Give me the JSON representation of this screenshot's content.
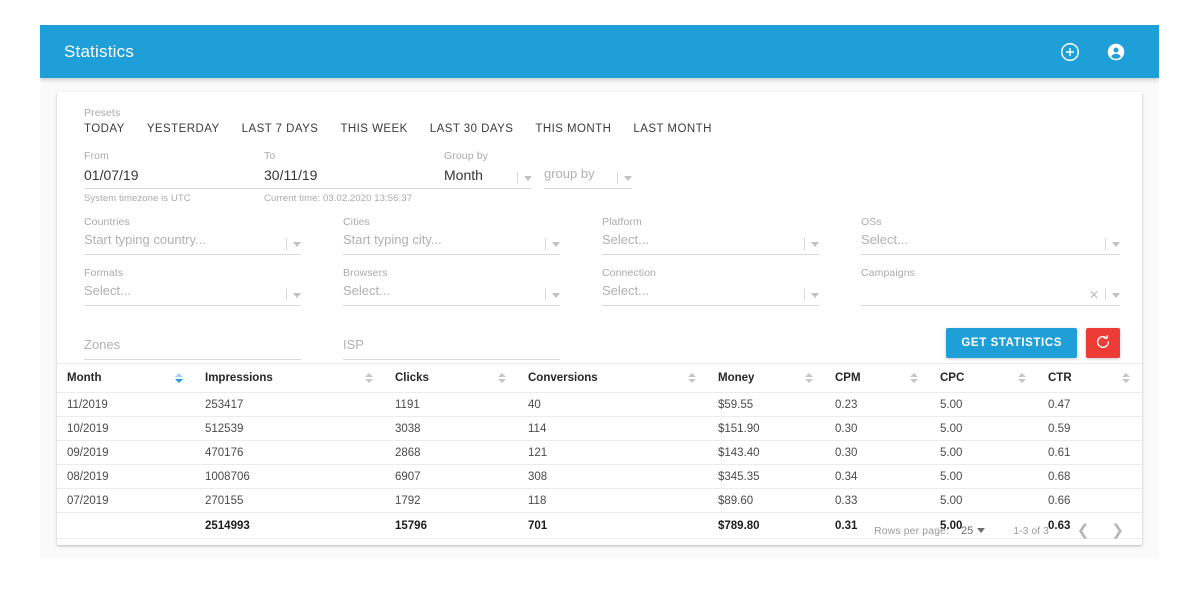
{
  "appbar": {
    "title": "Statistics",
    "add_icon": "plus-circle-icon",
    "account_icon": "account-circle-icon"
  },
  "colors": {
    "primary": "#1e9fd8",
    "danger": "#ed3b35",
    "surface": "#ffffff",
    "background": "#fafafa"
  },
  "filters": {
    "presets_label": "Presets",
    "presets": [
      "TODAY",
      "YESTERDAY",
      "LAST 7 DAYS",
      "THIS WEEK",
      "LAST 30 DAYS",
      "THIS MONTH",
      "LAST MONTH"
    ],
    "from": {
      "label": "From",
      "value": "01/07/19",
      "helper": "System timezone is UTC"
    },
    "to": {
      "label": "To",
      "value": "30/11/19",
      "helper": "Current time: 03.02.2020 13:56:37"
    },
    "group_by": {
      "label": "Group by",
      "primary_value": "Month",
      "secondary_placeholder": "group by"
    },
    "countries": {
      "label": "Countries",
      "placeholder": "Start typing country..."
    },
    "cities": {
      "label": "Cities",
      "placeholder": "Start typing city..."
    },
    "platform": {
      "label": "Platform",
      "placeholder": "Select..."
    },
    "oss": {
      "label": "OSs",
      "placeholder": "Select..."
    },
    "formats": {
      "label": "Formats",
      "placeholder": "Select..."
    },
    "browsers": {
      "label": "Browsers",
      "placeholder": "Select..."
    },
    "connection": {
      "label": "Connection",
      "placeholder": "Select..."
    },
    "campaigns": {
      "label": "Campaigns",
      "placeholder": "",
      "clear_icon": "close-x-icon"
    },
    "zones": {
      "placeholder": "Zones"
    },
    "isp": {
      "placeholder": "ISP"
    }
  },
  "actions": {
    "get_statistics": "GET STATISTICS",
    "reset_icon": "refresh-ccw-icon"
  },
  "table": {
    "columns": [
      {
        "label": "Month",
        "sorted": true
      },
      {
        "label": "Impressions",
        "sorted": false
      },
      {
        "label": "Clicks",
        "sorted": false
      },
      {
        "label": "Conversions",
        "sorted": false
      },
      {
        "label": "Money",
        "sorted": false
      },
      {
        "label": "CPM",
        "sorted": false
      },
      {
        "label": "CPC",
        "sorted": false
      },
      {
        "label": "CTR",
        "sorted": false
      }
    ],
    "rows": [
      {
        "month": "11/2019",
        "impressions": "253417",
        "clicks": "1191",
        "conversions": "40",
        "money": "$59.55",
        "cpm": "0.23",
        "cpc": "5.00",
        "ctr": "0.47"
      },
      {
        "month": "10/2019",
        "impressions": "512539",
        "clicks": "3038",
        "conversions": "114",
        "money": "$151.90",
        "cpm": "0.30",
        "cpc": "5.00",
        "ctr": "0.59"
      },
      {
        "month": "09/2019",
        "impressions": "470176",
        "clicks": "2868",
        "conversions": "121",
        "money": "$143.40",
        "cpm": "0.30",
        "cpc": "5.00",
        "ctr": "0.61"
      },
      {
        "month": "08/2019",
        "impressions": "1008706",
        "clicks": "6907",
        "conversions": "308",
        "money": "$345.35",
        "cpm": "0.34",
        "cpc": "5.00",
        "ctr": "0.68"
      },
      {
        "month": "07/2019",
        "impressions": "270155",
        "clicks": "1792",
        "conversions": "118",
        "money": "$89.60",
        "cpm": "0.33",
        "cpc": "5.00",
        "ctr": "0.66"
      }
    ],
    "total": {
      "month": "",
      "impressions": "2514993",
      "clicks": "15796",
      "conversions": "701",
      "money": "$789.80",
      "cpm": "0.31",
      "cpc": "5.00",
      "ctr": "0.63"
    }
  },
  "pagination": {
    "rows_per_page_label": "Rows per page:",
    "rows_per_page_value": "25",
    "range": "1-3 of 3",
    "prev_icon": "chevron-left-icon",
    "next_icon": "chevron-right-icon"
  }
}
